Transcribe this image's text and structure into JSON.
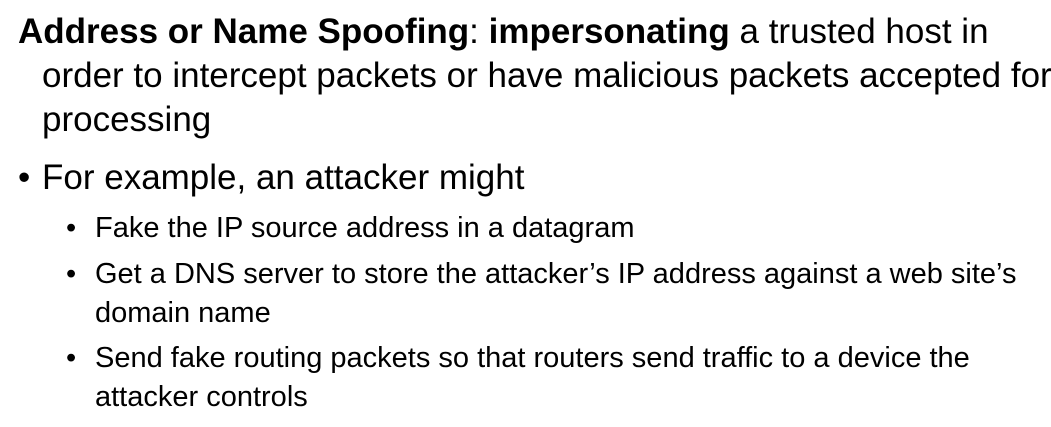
{
  "intro": {
    "term": "Address or Name Spoofing",
    "colon": ":",
    "emphasis": "impersonating",
    "rest": " a trusted host in order to intercept packets or have malicious packets accepted for processing"
  },
  "bullet_glyph": "•",
  "main_bullet": "For example, an attacker might",
  "sub_bullets": [
    "Fake the IP source address in a datagram",
    "Get a DNS server to store the attacker’s IP address against a web site’s domain name",
    "Send fake routing packets so that routers send traffic to a device the attacker controls"
  ]
}
